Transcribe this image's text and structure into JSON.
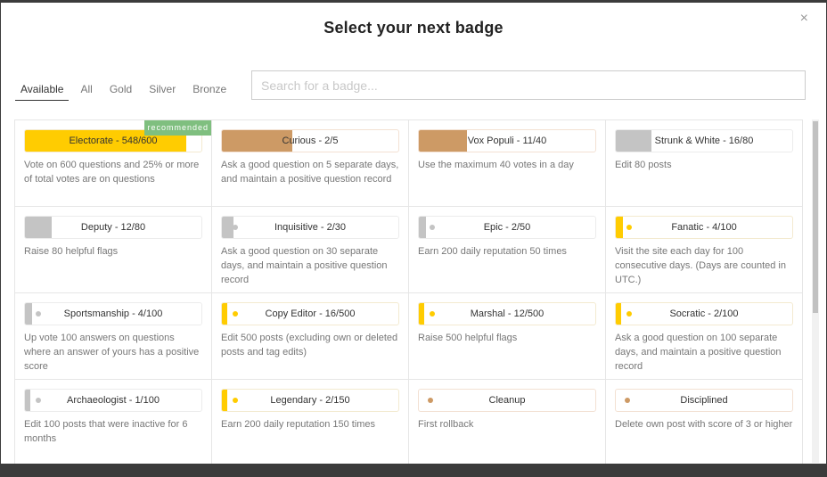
{
  "modal": {
    "title": "Select your next badge",
    "close_icon": "×",
    "tabs": [
      {
        "label": "Available",
        "active": true
      },
      {
        "label": "All",
        "active": false
      },
      {
        "label": "Gold",
        "active": false
      },
      {
        "label": "Silver",
        "active": false
      },
      {
        "label": "Bronze",
        "active": false
      }
    ],
    "search": {
      "value": "",
      "placeholder": "Search for a badge..."
    },
    "recommended_label": "recommended"
  },
  "colors": {
    "gold": "#ffcc01",
    "silver": "#c4c4c4",
    "bronze": "#cd9a65",
    "recommended": "#7fbf7f"
  },
  "badges": [
    {
      "label": "Electorate - 548/600",
      "tier": "gold",
      "progress": 0.913,
      "recommended": true,
      "description": "Vote on 600 questions and 25% or more of total votes are on questions"
    },
    {
      "label": "Curious - 2/5",
      "tier": "bronze",
      "progress": 0.4,
      "description": "Ask a good question on 5 separate days, and maintain a positive question record"
    },
    {
      "label": "Vox Populi - 11/40",
      "tier": "bronze",
      "progress": 0.275,
      "description": "Use the maximum 40 votes in a day"
    },
    {
      "label": "Strunk & White - 16/80",
      "tier": "silver",
      "progress": 0.2,
      "description": "Edit 80 posts"
    },
    {
      "label": "Deputy - 12/80",
      "tier": "silver",
      "progress": 0.15,
      "description": "Raise 80 helpful flags"
    },
    {
      "label": "Inquisitive - 2/30",
      "tier": "silver",
      "progress": 0.067,
      "description": "Ask a good question on 30 separate days, and maintain a positive question record"
    },
    {
      "label": "Epic - 2/50",
      "tier": "silver",
      "progress": 0.04,
      "description": "Earn 200 daily reputation 50 times"
    },
    {
      "label": "Fanatic - 4/100",
      "tier": "gold",
      "progress": 0.04,
      "description": "Visit the site each day for 100 consecutive days. (Days are counted in UTC.)"
    },
    {
      "label": "Sportsmanship - 4/100",
      "tier": "silver",
      "progress": 0.04,
      "description": "Up vote 100 answers on questions where an answer of yours has a positive score"
    },
    {
      "label": "Copy Editor - 16/500",
      "tier": "gold",
      "progress": 0.032,
      "description": "Edit 500 posts (excluding own or deleted posts and tag edits)"
    },
    {
      "label": "Marshal - 12/500",
      "tier": "gold",
      "progress": 0.024,
      "description": "Raise 500 helpful flags"
    },
    {
      "label": "Socratic - 2/100",
      "tier": "gold",
      "progress": 0.02,
      "description": "Ask a good question on 100 separate days, and maintain a positive question record"
    },
    {
      "label": "Archaeologist - 1/100",
      "tier": "silver",
      "progress": 0.01,
      "description": "Edit 100 posts that were inactive for 6 months"
    },
    {
      "label": "Legendary - 2/150",
      "tier": "gold",
      "progress": 0.013,
      "description": "Earn 200 daily reputation 150 times"
    },
    {
      "label": "Cleanup",
      "tier": "bronze",
      "progress": 0,
      "description": "First rollback"
    },
    {
      "label": "Disciplined",
      "tier": "bronze",
      "progress": 0,
      "description": "Delete own post with score of 3 or higher"
    }
  ]
}
